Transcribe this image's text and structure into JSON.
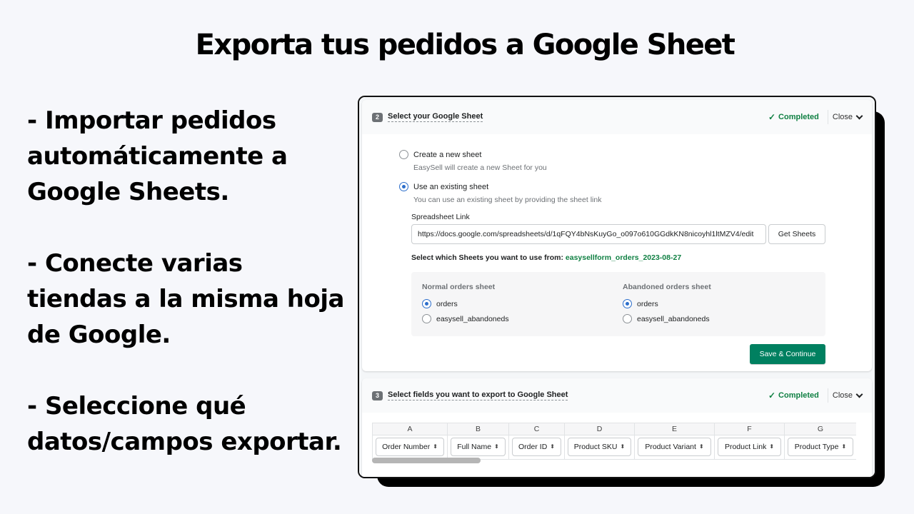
{
  "headline": "Exporta tus pedidos a Google Sheet",
  "bullets": [
    "- Importar pedidos automáticamente a Google Sheets.",
    "- Conecte varias tiendas a la misma hoja de Google.",
    "- Seleccione qué datos/campos exportar."
  ],
  "colors": {
    "accent_green": "#008060",
    "completed_green": "#108043",
    "radio_blue": "#2c6ecb"
  },
  "step2": {
    "number": "2",
    "title": "Select your Google Sheet",
    "status": "Completed",
    "status_icon": "check-icon",
    "close_label": "Close",
    "options": [
      {
        "label": "Create a new sheet",
        "help": "EasySell will create a new Sheet for you",
        "selected": false
      },
      {
        "label": "Use an existing sheet",
        "help": "You can use an existing sheet by providing the sheet link",
        "selected": true
      }
    ],
    "link_label": "Spreadsheet Link",
    "link_value": "https://docs.google.com/spreadsheets/d/1qFQY4bNsKuyGo_o097o610GGdkKN8nicoyhl1ltMZV4/edit",
    "get_sheets_label": "Get Sheets",
    "select_from_label": "Select which Sheets you want to use from:",
    "select_from_sheet": "easysellform_orders_2023-08-27",
    "normal": {
      "title": "Normal orders sheet",
      "options": [
        "orders",
        "easysell_abandoneds"
      ],
      "selected": "orders"
    },
    "abandoned": {
      "title": "Abandoned orders sheet",
      "options": [
        "orders",
        "easysell_abandoneds"
      ],
      "selected": "orders"
    },
    "save_label": "Save & Continue"
  },
  "step3": {
    "number": "3",
    "title": "Select fields you want to export to Google Sheet",
    "status": "Completed",
    "close_label": "Close",
    "columns": [
      {
        "letter": "A",
        "field": "Order Number"
      },
      {
        "letter": "B",
        "field": "Full Name"
      },
      {
        "letter": "C",
        "field": "Order ID"
      },
      {
        "letter": "D",
        "field": "Product SKU"
      },
      {
        "letter": "E",
        "field": "Product Variant"
      },
      {
        "letter": "F",
        "field": "Product Link"
      },
      {
        "letter": "G",
        "field": "Product Type"
      }
    ]
  }
}
